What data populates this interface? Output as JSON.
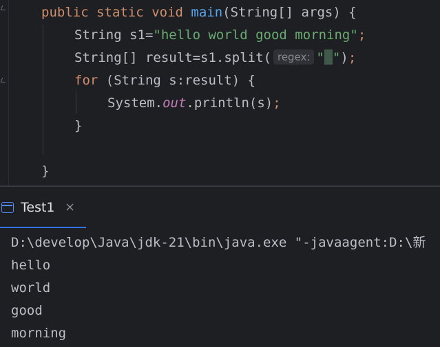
{
  "editor": {
    "line1": {
      "kw1": "public",
      "kw2": "static",
      "kw3": "void",
      "method": "main",
      "rest": "(String[] args) {"
    },
    "line2": {
      "decl": "String s1=",
      "string": "\"hello world good morning\"",
      "semi": ";"
    },
    "line3": {
      "decl": "String[] result=s1.split(",
      "hint": "regex:",
      "string_open": "\"",
      "string_close": "\"",
      "close": ")",
      "semi": ";"
    },
    "line4": {
      "kw": "for",
      "rest": " (String s:result) {"
    },
    "line5": {
      "obj": "System.",
      "field": "out",
      "call": ".println(s)",
      "semi": ";"
    },
    "line6": {
      "brace": "}"
    },
    "line8": {
      "brace": "}"
    }
  },
  "run_panel": {
    "tab_label": "Test1",
    "close_glyph": "×",
    "icon": "console-window-icon"
  },
  "console": {
    "lines": [
      "D:\\develop\\Java\\jdk-21\\bin\\java.exe \"-javaagent:D:\\新",
      "hello",
      "world",
      "good",
      "morning"
    ]
  },
  "colors": {
    "background": "#1e1f22",
    "keyword": "#cf8e6d",
    "method": "#56a8f5",
    "string": "#6aab73",
    "static_field": "#c77dbb",
    "text": "#bcbec4",
    "tab_underline": "#3574f0"
  }
}
